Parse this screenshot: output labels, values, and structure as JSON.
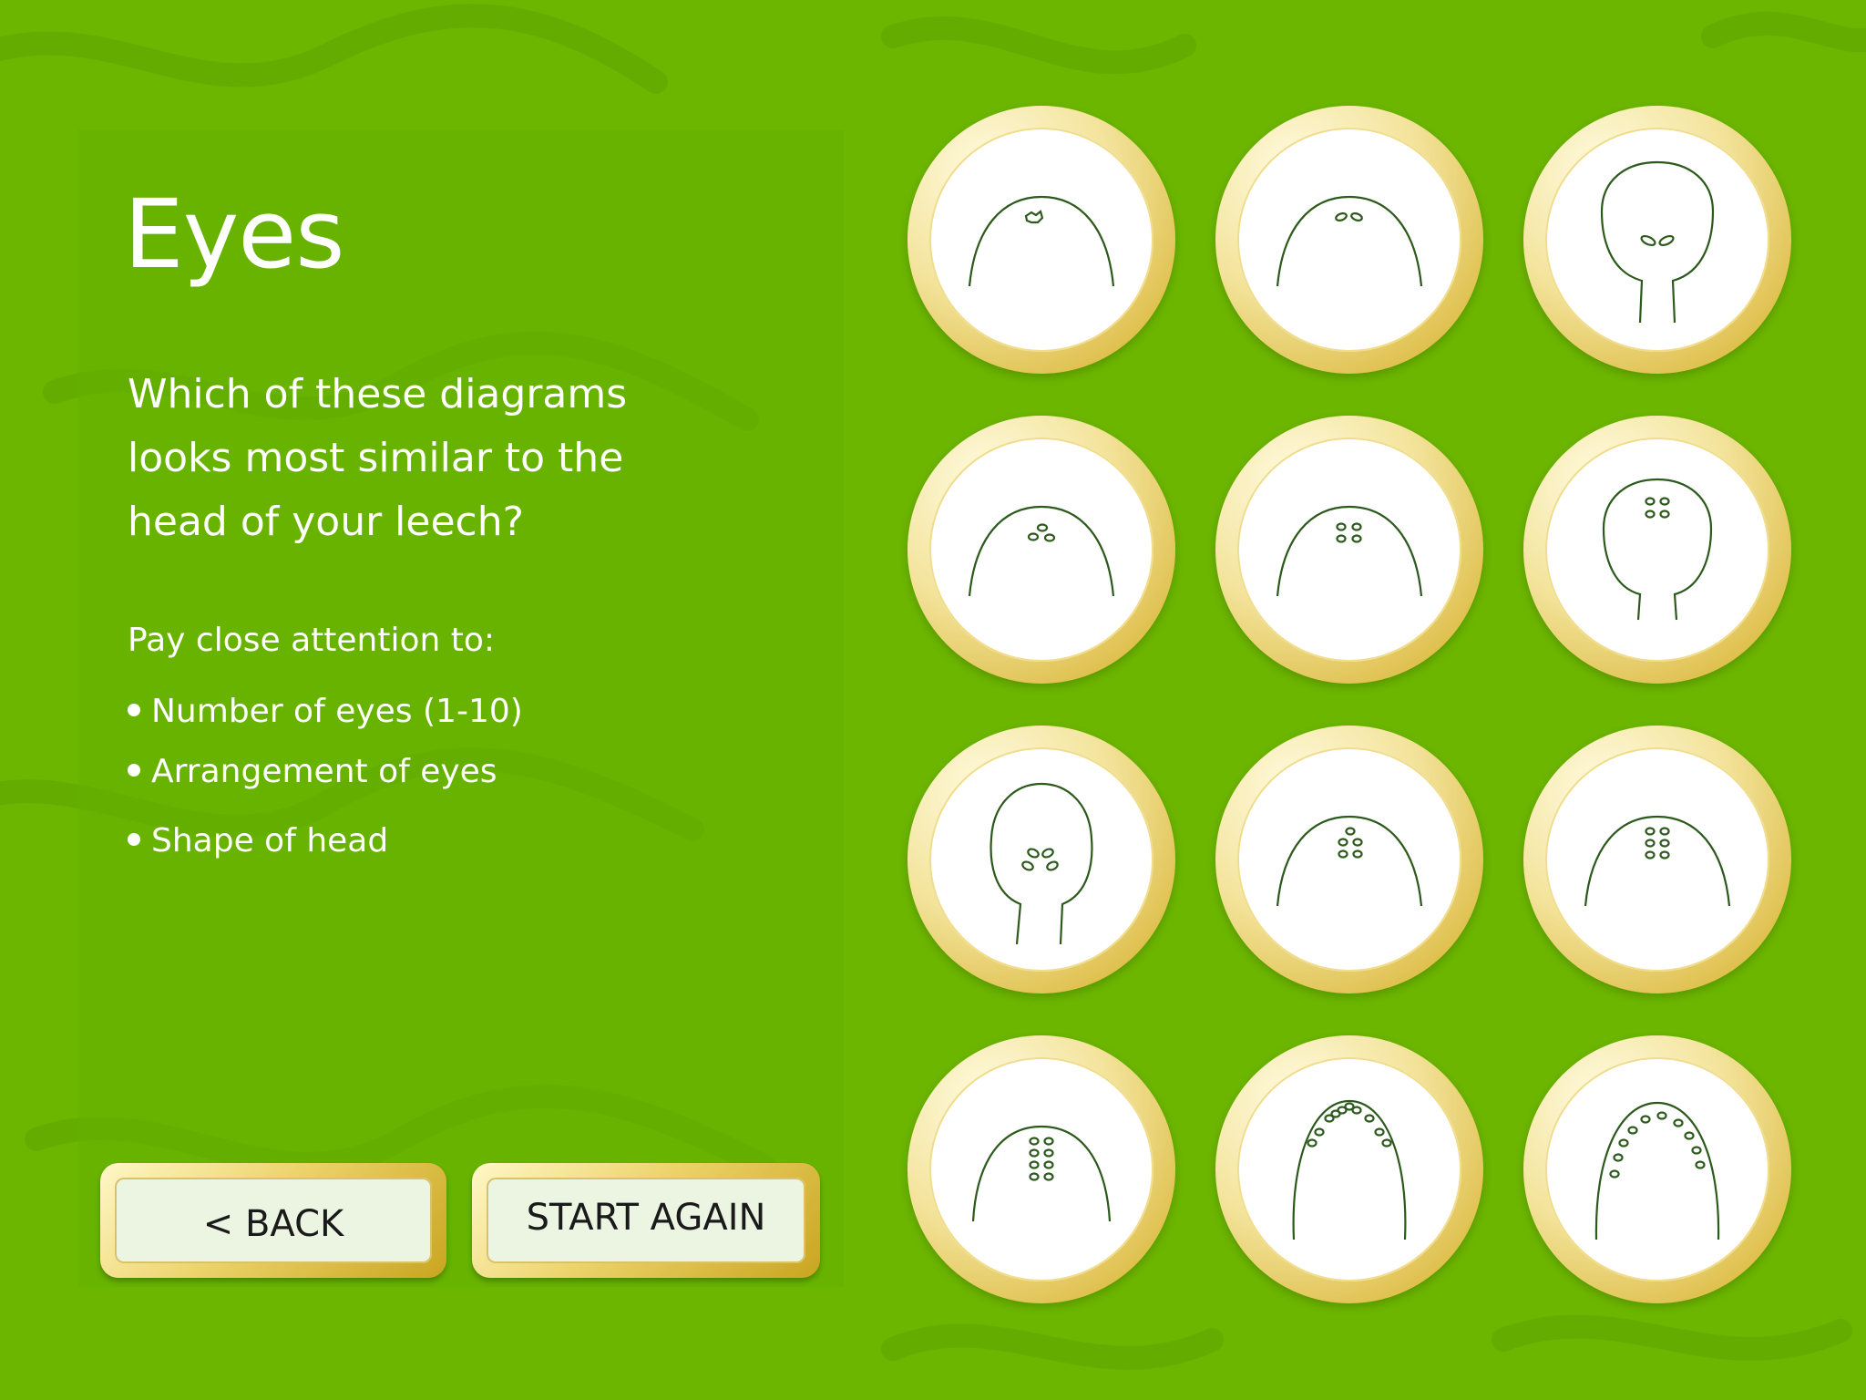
{
  "page": {
    "title": "Eyes",
    "question": "Which of these diagrams looks most similar to the head of your leech?",
    "hint": "Pay close attention to:",
    "bullets": [
      "Number of eyes (1-10)",
      "Arrangement of eyes",
      "Shape of head"
    ]
  },
  "buttons": {
    "back_label": "< BACK",
    "start_again_label": "START AGAIN"
  },
  "options": [
    {
      "icon": "leech-head-1-eye-icon"
    },
    {
      "icon": "leech-head-2-eyes-icon"
    },
    {
      "icon": "leech-head-2-eyes-narrow-neck-icon"
    },
    {
      "icon": "leech-head-3-eyes-icon"
    },
    {
      "icon": "leech-head-4-eyes-icon"
    },
    {
      "icon": "leech-head-4-eyes-narrow-neck-icon"
    },
    {
      "icon": "leech-head-4-eyes-long-neck-icon"
    },
    {
      "icon": "leech-head-5-eyes-icon"
    },
    {
      "icon": "leech-head-6-eyes-icon"
    },
    {
      "icon": "leech-head-8-eyes-icon"
    },
    {
      "icon": "leech-head-10-eyes-ring-icon"
    },
    {
      "icon": "leech-head-10-eyes-ring-wide-icon"
    }
  ],
  "colors": {
    "background": "#6cb600",
    "panel": "#64b000",
    "gold": "#dfc04e",
    "button_face": "#ecf5e2",
    "ink": "#2c5a1c"
  }
}
